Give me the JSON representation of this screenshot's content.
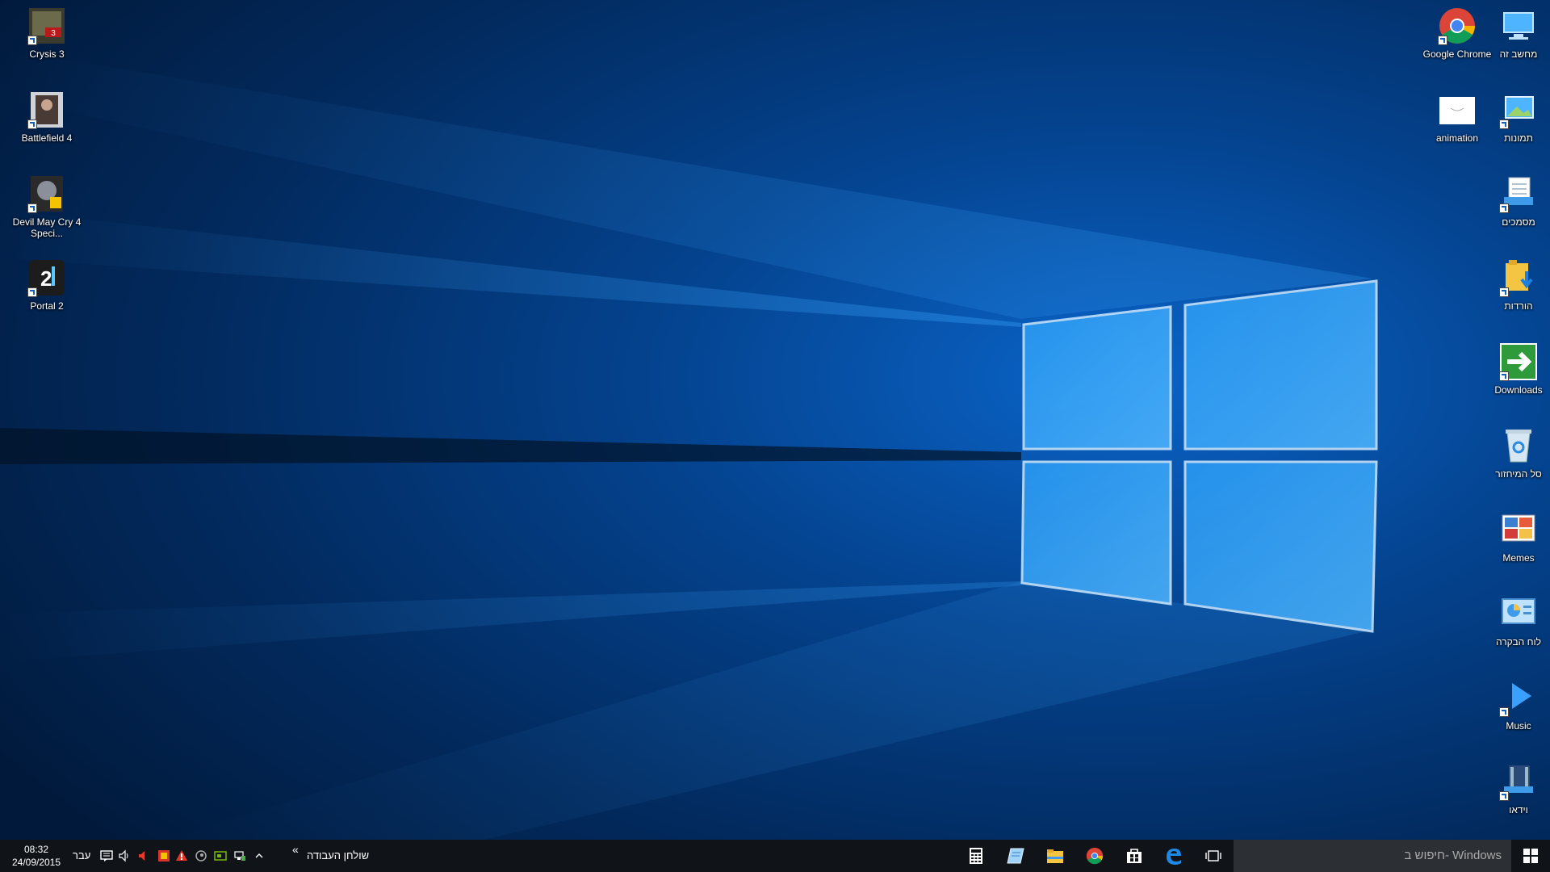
{
  "desktop": {
    "left_icons": [
      {
        "label": "Crysis 3",
        "icon": "crysis-3-icon"
      },
      {
        "label": "Battlefield 4",
        "icon": "battlefield-4-icon"
      },
      {
        "label": "Devil May Cry 4 Speci...",
        "icon": "devil-may-cry-icon"
      },
      {
        "label": "Portal 2",
        "icon": "portal-2-icon"
      }
    ],
    "right_icons": [
      {
        "label": "מחשב זה",
        "icon": "this-pc-icon"
      },
      {
        "label": "Google Chrome",
        "icon": "chrome-icon"
      },
      {
        "label": "תמונות",
        "icon": "pictures-icon"
      },
      {
        "label": "animation",
        "icon": "animation-icon"
      },
      {
        "label": "מסמכים",
        "icon": "documents-icon"
      },
      {
        "label": "הורדות",
        "icon": "downloads-folder-icon"
      },
      {
        "label": "Downloads",
        "icon": "downloads-shortcut-icon"
      },
      {
        "label": "סל המיחזור",
        "icon": "recycle-bin-icon"
      },
      {
        "label": "Memes",
        "icon": "memes-icon"
      },
      {
        "label": "לוח הבקרה",
        "icon": "control-panel-icon"
      },
      {
        "label": "Music",
        "icon": "music-icon"
      },
      {
        "label": "וידאו",
        "icon": "videos-icon"
      }
    ]
  },
  "taskbar": {
    "search_placeholder": "חיפוש ב- Windows",
    "clock_time": "08:32",
    "clock_date": "24/09/2015",
    "language": "עבר",
    "desktop_toolbar_label": "שולחן העבודה",
    "toolbar_chevron": "«",
    "pinned_apps": [
      "calculator-icon",
      "notepad-icon",
      "file-explorer-icon",
      "chrome-icon",
      "store-icon",
      "edge-icon",
      "task-view-icon"
    ]
  },
  "colors": {
    "wallpaper_dark": "#02224d",
    "wallpaper_light": "#3aa8ff",
    "taskbar": "#101418",
    "search_box": "#2c2f33"
  }
}
